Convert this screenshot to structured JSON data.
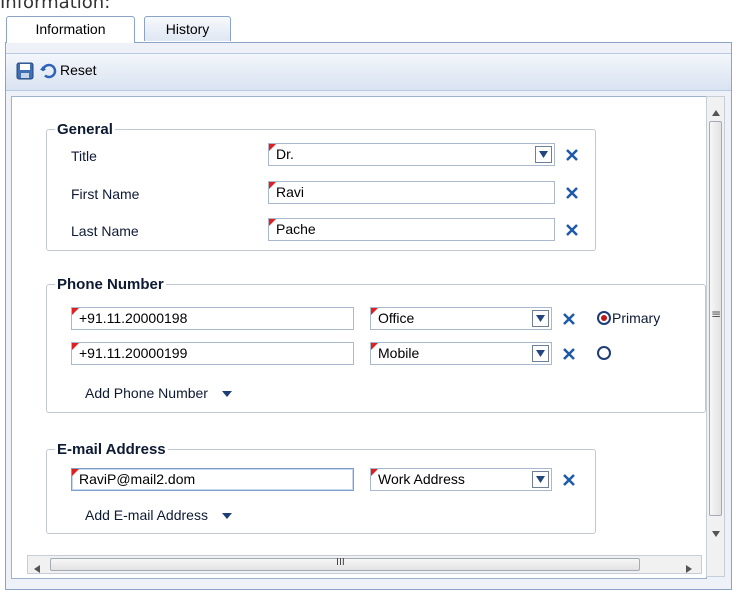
{
  "window": {
    "partial_title": "Information:"
  },
  "tabs": [
    {
      "label": "Information",
      "active": true
    },
    {
      "label": "History",
      "active": false
    }
  ],
  "toolbar": {
    "save_icon": "save-icon",
    "reset_label": "Reset"
  },
  "general": {
    "legend": "General",
    "title_label": "Title",
    "title_value": "Dr.",
    "first_name_label": "First Name",
    "first_name_value": "Ravi",
    "last_name_label": "Last Name",
    "last_name_value": "Pache"
  },
  "phone": {
    "legend": "Phone Number",
    "rows": [
      {
        "number": "+91.11.20000198",
        "type": "Office",
        "primary": true
      },
      {
        "number": "+91.11.20000199",
        "type": "Mobile",
        "primary": false
      }
    ],
    "primary_label": "Primary",
    "add_label": "Add Phone Number"
  },
  "email": {
    "legend": "E-mail Address",
    "address": "RaviP@mail2.dom",
    "type": "Work Address",
    "add_label": "Add E-mail Address"
  },
  "scrollbar": {
    "grip": "≡",
    "h_grip": "III"
  },
  "colors": {
    "accent": "#1e5aa8",
    "required_flag": "#e02020",
    "remove_x": "#1e5aa8"
  }
}
